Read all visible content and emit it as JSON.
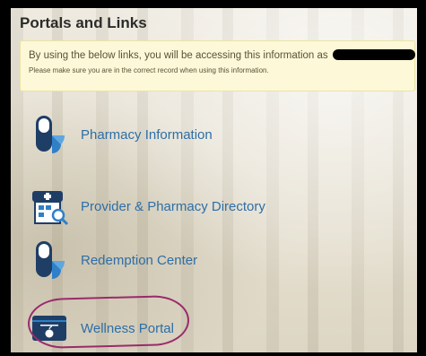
{
  "section": {
    "title": "Portals and Links"
  },
  "notice": {
    "line1": "By using the below links, you will be accessing this information as",
    "line2": "Please make sure you are in the correct record when using this information."
  },
  "links": [
    {
      "label": "Pharmacy Information",
      "icon": "pill-icon"
    },
    {
      "label": "Provider & Pharmacy Directory",
      "icon": "storefront-directory-icon"
    },
    {
      "label": "Redemption Center",
      "icon": "pill-icon"
    },
    {
      "label": "Wellness Portal",
      "icon": "wellness-card-icon"
    }
  ],
  "colors": {
    "link_text": "#2e6ea6",
    "icon_navy": "#1f3e66",
    "icon_blue": "#2f80c8",
    "notice_bg": "#fcf8d8",
    "highlight_annotation": "#9b2a6c"
  }
}
